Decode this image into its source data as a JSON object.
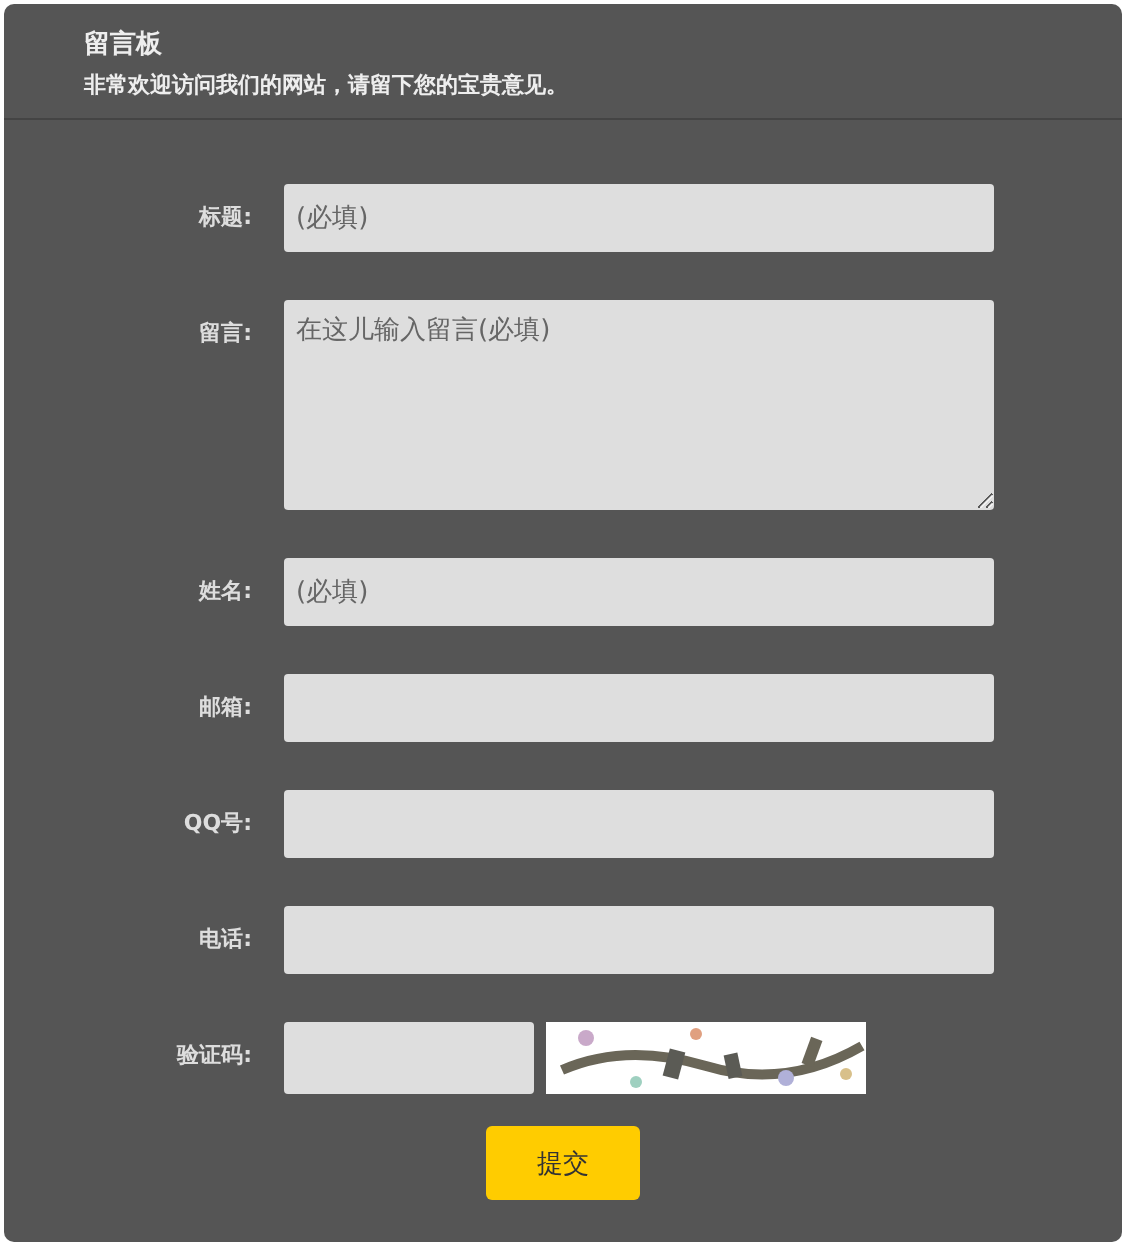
{
  "header": {
    "title": "留言板",
    "subtitle": "非常欢迎访问我们的网站，请留下您的宝贵意见。"
  },
  "fields": [
    {
      "kind": "input",
      "label": "标题:",
      "placeholder": "(必填)"
    },
    {
      "kind": "textarea",
      "label": "留言:",
      "placeholder": "在这儿输入留言(必填)"
    },
    {
      "kind": "input",
      "label": "姓名:",
      "placeholder": "(必填)"
    },
    {
      "kind": "input",
      "label": "邮箱:"
    },
    {
      "kind": "input",
      "label": "QQ号:"
    },
    {
      "kind": "input",
      "label": "电话:"
    },
    {
      "kind": "captcha",
      "label": "验证码:"
    }
  ],
  "submit": "提交"
}
